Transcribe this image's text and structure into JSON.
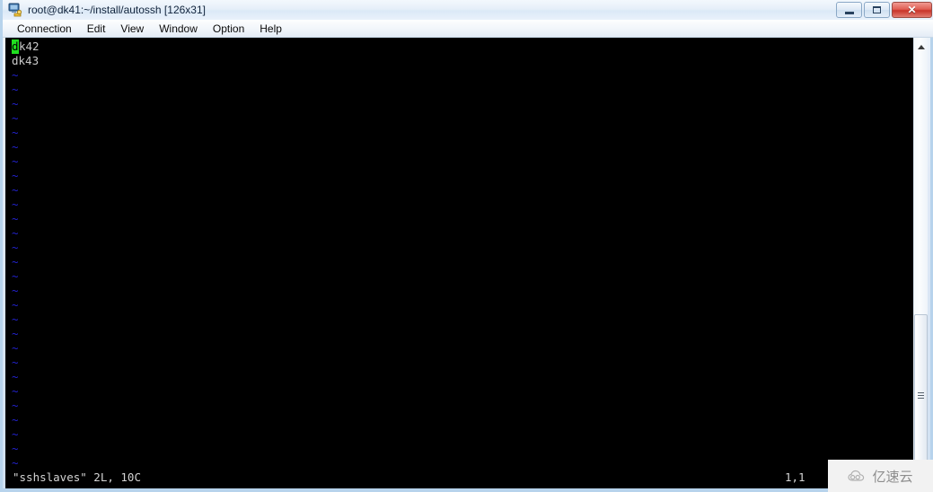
{
  "window": {
    "title": "root@dk41:~/install/autossh [126x31]",
    "icon": "terminal-app-icon",
    "controls": {
      "minimize": "–",
      "maximize": "❐",
      "close": "✕"
    }
  },
  "menubar": {
    "items": [
      {
        "label": "Connection"
      },
      {
        "label": "Edit"
      },
      {
        "label": "View"
      },
      {
        "label": "Window"
      },
      {
        "label": "Option"
      },
      {
        "label": "Help"
      }
    ]
  },
  "terminal": {
    "cols": 126,
    "rows": 31,
    "background_color": "#000000",
    "foreground_color": "#c9c9c9",
    "tilde_color": "#2222cc",
    "cursor_color": "#20e020",
    "cursor_char": "d",
    "lines": [
      {
        "type": "text",
        "cursor": true,
        "text": "dk42"
      },
      {
        "type": "text",
        "cursor": false,
        "text": "dk43"
      },
      {
        "type": "tilde",
        "text": "~"
      },
      {
        "type": "tilde",
        "text": "~"
      },
      {
        "type": "tilde",
        "text": "~"
      },
      {
        "type": "tilde",
        "text": "~"
      },
      {
        "type": "tilde",
        "text": "~"
      },
      {
        "type": "tilde",
        "text": "~"
      },
      {
        "type": "tilde",
        "text": "~"
      },
      {
        "type": "tilde",
        "text": "~"
      },
      {
        "type": "tilde",
        "text": "~"
      },
      {
        "type": "tilde",
        "text": "~"
      },
      {
        "type": "tilde",
        "text": "~"
      },
      {
        "type": "tilde",
        "text": "~"
      },
      {
        "type": "tilde",
        "text": "~"
      },
      {
        "type": "tilde",
        "text": "~"
      },
      {
        "type": "tilde",
        "text": "~"
      },
      {
        "type": "tilde",
        "text": "~"
      },
      {
        "type": "tilde",
        "text": "~"
      },
      {
        "type": "tilde",
        "text": "~"
      },
      {
        "type": "tilde",
        "text": "~"
      },
      {
        "type": "tilde",
        "text": "~"
      },
      {
        "type": "tilde",
        "text": "~"
      },
      {
        "type": "tilde",
        "text": "~"
      },
      {
        "type": "tilde",
        "text": "~"
      },
      {
        "type": "tilde",
        "text": "~"
      },
      {
        "type": "tilde",
        "text": "~"
      },
      {
        "type": "tilde",
        "text": "~"
      },
      {
        "type": "tilde",
        "text": "~"
      },
      {
        "type": "tilde",
        "text": "~"
      }
    ]
  },
  "statusline": {
    "file_info": "\"sshslaves\" 2L, 10C",
    "cursor_position": "1,1"
  },
  "scrollbar": {
    "up_arrow": "scroll-up-arrow",
    "thumb_grip": "scrollbar-grip"
  },
  "watermark": {
    "text": "亿速云",
    "logo": "cloud-logo"
  }
}
